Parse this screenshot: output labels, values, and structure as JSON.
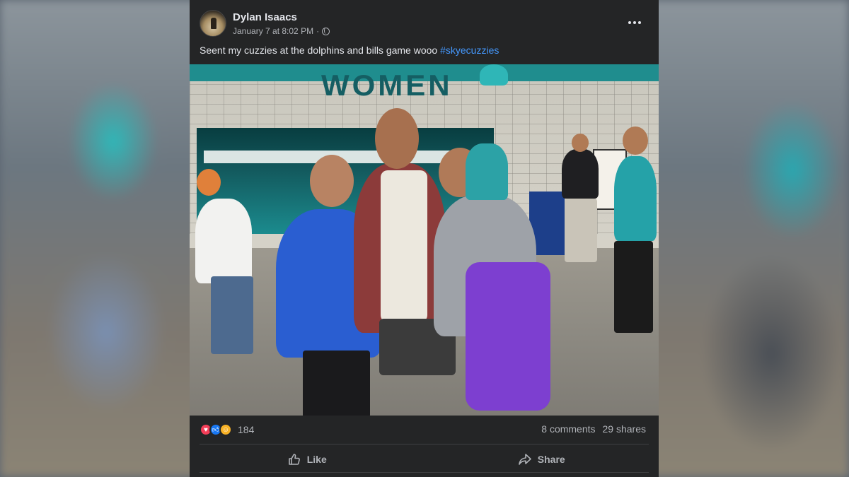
{
  "post": {
    "author": "Dylan Isaacs",
    "timestamp": "January 7 at 8:02 PM",
    "separator": "·",
    "visibility_icon": "globe-icon",
    "more_icon": "more-options-icon",
    "caption_text": "Seent my cuzzies at the dolphins and bills game wooo ",
    "hashtag": "#skyecuzzies"
  },
  "photo": {
    "sign_text": "WOMEN"
  },
  "stats": {
    "reaction_icons": [
      "love-icon",
      "like-icon",
      "care-icon"
    ],
    "reaction_count": "184",
    "comments": "8 comments",
    "shares": "29 shares"
  },
  "actions": {
    "like_label": "Like",
    "share_label": "Share"
  },
  "colors": {
    "card_bg": "#242526",
    "text_primary": "#e4e6eb",
    "text_secondary": "#b0b3b8",
    "hashtag": "#4599ff"
  }
}
